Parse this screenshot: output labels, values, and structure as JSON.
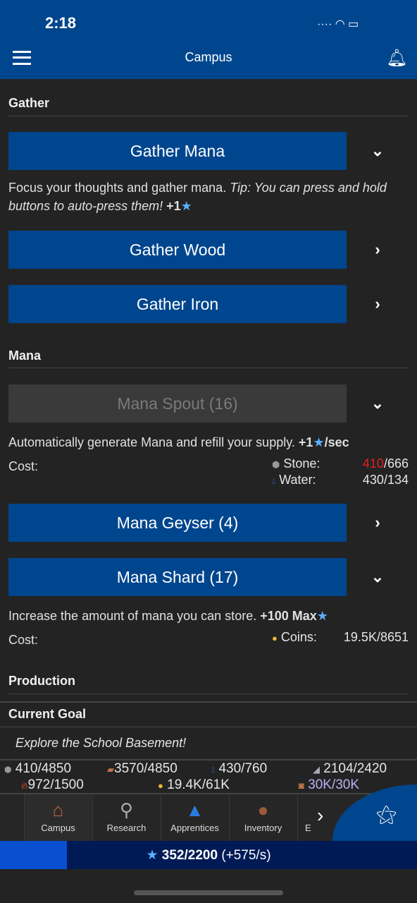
{
  "status": {
    "time": "2:18"
  },
  "header": {
    "title": "Campus",
    "menu_icon": "hamburger-icon",
    "bell_icon": "bell-icon"
  },
  "gather": {
    "title": "Gather",
    "mana_button": "Gather Mana",
    "mana_desc": "Focus your thoughts and gather mana.",
    "mana_tip": "Tip: You can press and hold buttons to auto-press them!",
    "mana_gain": "+1",
    "wood_button": "Gather Wood",
    "iron_button": "Gather Iron"
  },
  "mana": {
    "title": "Mana",
    "spout_button": "Mana Spout (16)",
    "spout_desc": "Automatically generate Mana and refill your supply.",
    "spout_gain": "+1",
    "spout_unit": "/sec",
    "cost_label": "Cost:",
    "spout_costs": [
      {
        "name": "Stone:",
        "have": "410",
        "need": "/666",
        "insufficient": true
      },
      {
        "name": "Water:",
        "have": "430",
        "need": "/134",
        "insufficient": false
      }
    ],
    "geyser_button": "Mana Geyser (4)",
    "shard_button": "Mana Shard (17)",
    "shard_desc": "Increase the amount of mana you can store.",
    "shard_gain": "+100 Max",
    "shard_costs": [
      {
        "name": "Coins:",
        "value": "19.5K/8651"
      }
    ]
  },
  "production": {
    "title": "Production"
  },
  "goal": {
    "title": "Current Goal",
    "text": "Explore the School Basement!"
  },
  "resources": {
    "stone": "410/4850",
    "wood": "3570/4850",
    "water": "430/760",
    "iron": "2104/2420",
    "fire": "972/1500",
    "coins": "19.4K/61K",
    "time": "30K/30K"
  },
  "tabs": [
    {
      "label": "Campus",
      "icon": "house-icon"
    },
    {
      "label": "Research",
      "icon": "magnifier-icon"
    },
    {
      "label": "Apprentices",
      "icon": "wizard-hat-icon"
    },
    {
      "label": "Inventory",
      "icon": "bag-icon"
    },
    {
      "label": "E"
    }
  ],
  "mana_bar": {
    "value": "352/2200",
    "rate": "(+575/s)",
    "fraction": 0.16
  },
  "colors": {
    "accent": "#00468e",
    "insufficient": "#e02020",
    "bar_fill": "#0a4fd0",
    "bar_bg": "#001a55"
  }
}
